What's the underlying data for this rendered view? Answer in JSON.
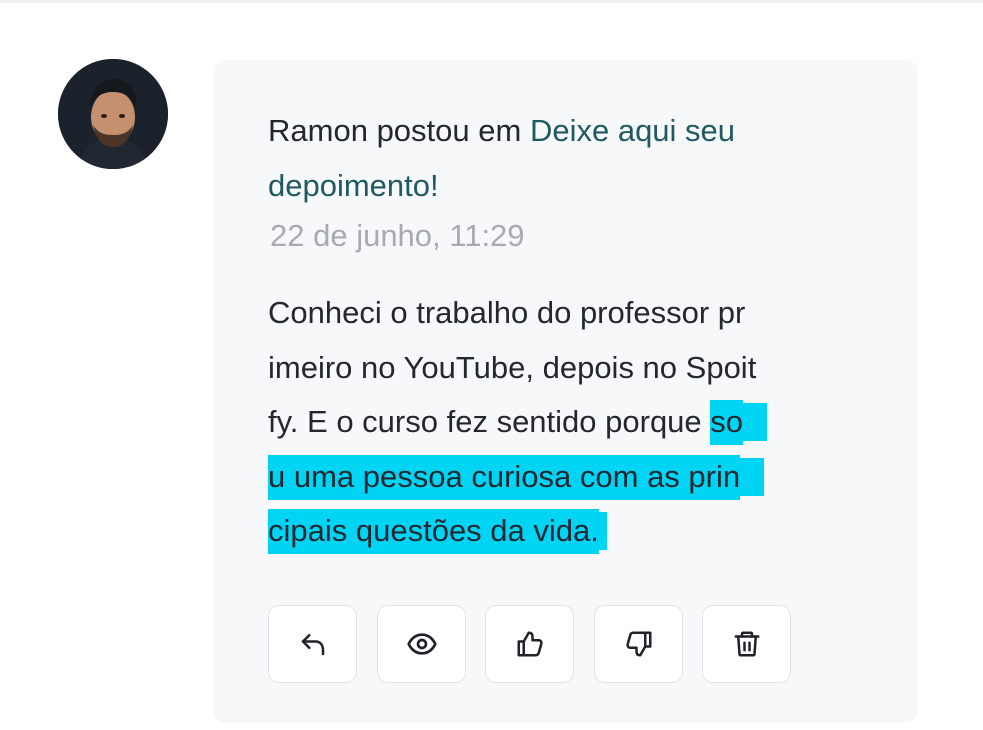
{
  "post": {
    "author": "Ramon",
    "action_text": "postou em",
    "topic_link": "Deixe aqui seu depoimento!",
    "topic_line1": "Deixe aqui seu",
    "topic_line2": "depoimento!",
    "timestamp": "22 de junho, 11:29",
    "body_lines": [
      "Conheci o trabalho do professor pr",
      "imeiro no YouTube, depois no Spoit",
      "fy. E o curso fez sentido porque "
    ],
    "highlighted_lines": [
      "so",
      "u uma pessoa curiosa com as prin",
      "cipais questões da vida."
    ]
  },
  "actions": [
    {
      "name": "reply",
      "icon": "reply-icon"
    },
    {
      "name": "view",
      "icon": "eye-icon"
    },
    {
      "name": "like",
      "icon": "thumbs-up-icon"
    },
    {
      "name": "dislike",
      "icon": "thumbs-down-icon"
    },
    {
      "name": "delete",
      "icon": "trash-icon"
    }
  ],
  "colors": {
    "highlight": "#00d4f5",
    "link": "#1f5a60",
    "timestamp": "#a6abb3",
    "card_bg": "#f7f8fa"
  }
}
